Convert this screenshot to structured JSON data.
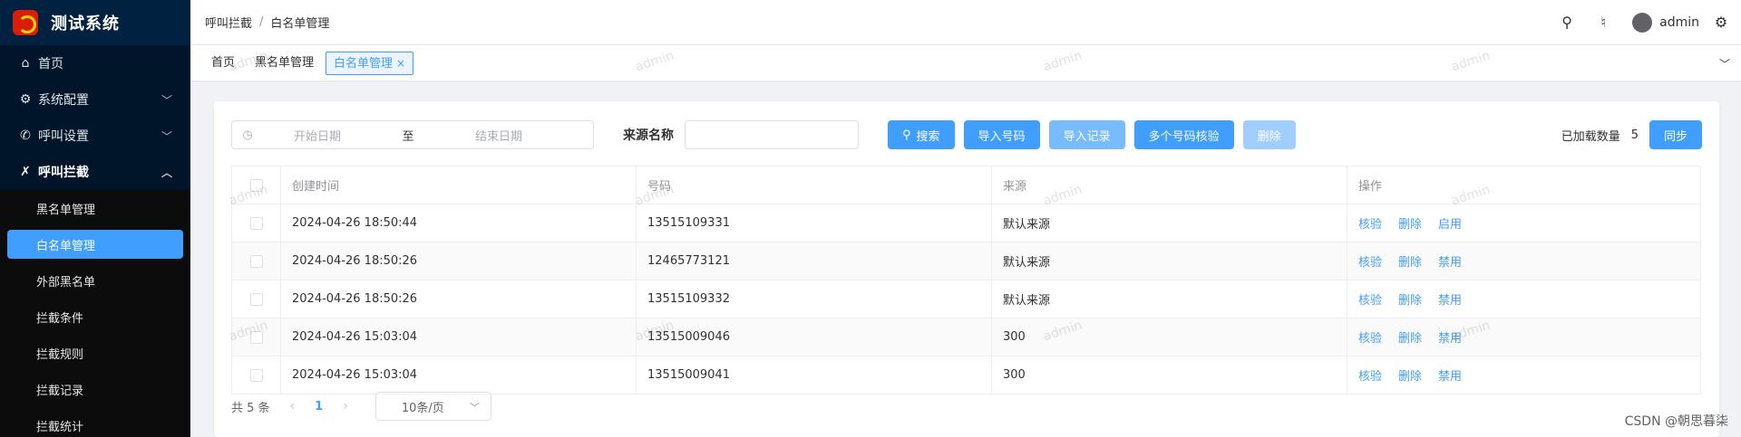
{
  "app": {
    "title": "测试系统"
  },
  "sidebar": {
    "items": [
      {
        "label": "首页",
        "icon": "home-icon",
        "glyph": "⌂"
      },
      {
        "label": "系统配置",
        "icon": "gear-icon",
        "glyph": "⚙"
      },
      {
        "label": "呼叫设置",
        "icon": "phone-icon",
        "glyph": "✆"
      },
      {
        "label": "呼叫拦截",
        "icon": "phone-block-icon",
        "glyph": "✗"
      }
    ],
    "submenu": [
      "黑名单管理",
      "白名单管理",
      "外部黑名单",
      "拦截条件",
      "拦截规则",
      "拦截记录",
      "拦截统计"
    ]
  },
  "header": {
    "breadcrumb": [
      "呼叫拦截",
      "白名单管理"
    ],
    "username": "admin"
  },
  "tags": [
    "首页",
    "黑名单管理",
    "白名单管理"
  ],
  "toolbar": {
    "start_placeholder": "开始日期",
    "range_sep": "至",
    "end_placeholder": "结束日期",
    "source_label": "来源名称",
    "search": "搜索",
    "import_numbers": "导入号码",
    "import_records": "导入记录",
    "multi_verify": "多个号码核验",
    "delete": "删除",
    "loaded_label": "已加载数量",
    "loaded_count": "5",
    "sync": "同步"
  },
  "table": {
    "headers": [
      "创建时间",
      "号码",
      "来源",
      "操作"
    ],
    "rows": [
      {
        "time": "2024-04-26 18:50:44",
        "number": "13515109331",
        "source": "默认来源",
        "ops": [
          "核验",
          "删除",
          "启用"
        ]
      },
      {
        "time": "2024-04-26 18:50:26",
        "number": "12465773121",
        "source": "默认来源",
        "ops": [
          "核验",
          "删除",
          "禁用"
        ]
      },
      {
        "time": "2024-04-26 18:50:26",
        "number": "13515109332",
        "source": "默认来源",
        "ops": [
          "核验",
          "删除",
          "禁用"
        ]
      },
      {
        "time": "2024-04-26 15:03:04",
        "number": "13515009046",
        "source": "300",
        "ops": [
          "核验",
          "删除",
          "禁用"
        ]
      },
      {
        "time": "2024-04-26 15:03:04",
        "number": "13515009041",
        "source": "300",
        "ops": [
          "核验",
          "删除",
          "禁用"
        ]
      }
    ]
  },
  "pagination": {
    "total": "共 5 条",
    "current": "1",
    "page_size": "10条/页"
  },
  "watermark": "admin",
  "credit": "CSDN @朝思暮柒",
  "colors": {
    "primary": "#409eff",
    "sidebar": "#001529"
  }
}
